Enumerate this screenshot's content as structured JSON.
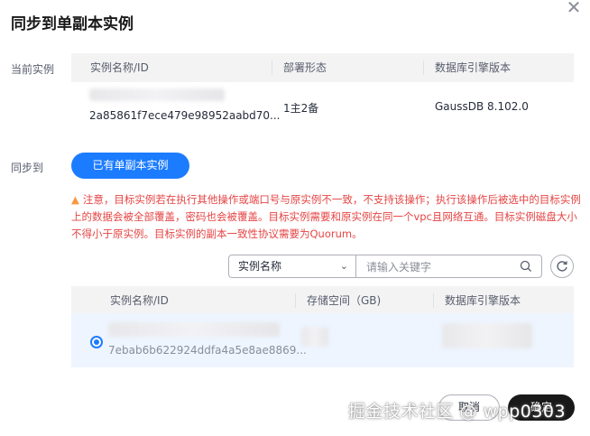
{
  "dialog": {
    "title": "同步到单副本实例"
  },
  "current": {
    "label": "当前实例",
    "columns": [
      "实例名称/ID",
      "部署形态",
      "数据库引擎版本"
    ],
    "row": {
      "id": "2a85861f7ece479e98952aabd70...",
      "deploy": "1主2备",
      "engine": "GaussDB 8.102.0"
    }
  },
  "sync": {
    "label": "同步到",
    "button": "已有单副本实例"
  },
  "warning": {
    "text": "注意，目标实例若在执行其他操作或端口号与原实例不一致，不支持该操作；执行该操作后被选中的目标实例上的数据会被全部覆盖，密码也会被覆盖。目标实例需要和原实例在同一个vpc且网络互通。目标实例磁盘大小不得小于原实例。目标实例的副本一致性协议需要为Quorum。"
  },
  "filter": {
    "selected": "实例名称",
    "placeholder": "请输入关键字"
  },
  "target": {
    "columns": [
      "实例名称/ID",
      "存储空间（GB)",
      "数据库引擎版本"
    ],
    "row": {
      "id": "7ebab6b622924ddfa4a5e8ae8869..."
    }
  },
  "footer": {
    "cancel": "取消",
    "ok": "确定"
  },
  "watermark": "掘金技术社区 @ wpp0303",
  "colors": {
    "primary": "#1c7cff",
    "warning_text": "#e54545",
    "warning_icon": "#fa9841",
    "ok_button": "#191919"
  }
}
